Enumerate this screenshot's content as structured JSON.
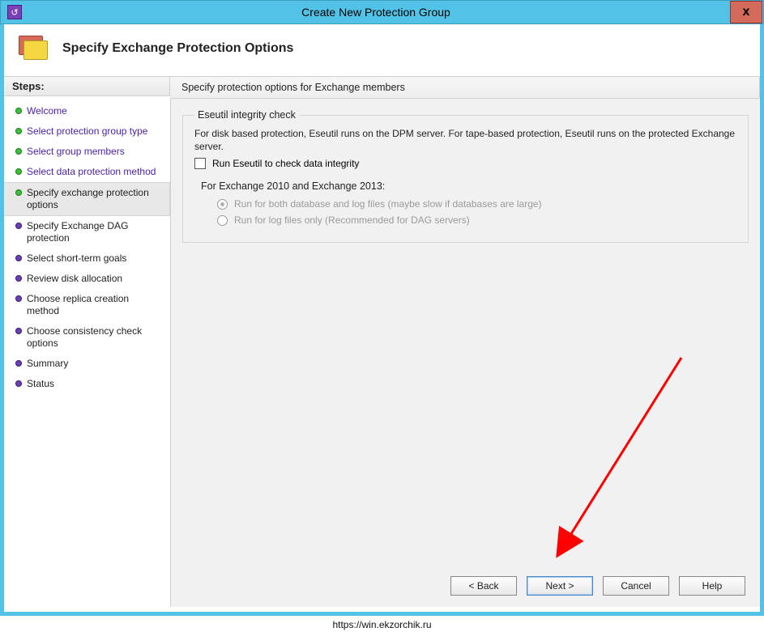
{
  "window": {
    "title": "Create New Protection Group"
  },
  "header": {
    "title": "Specify Exchange Protection Options"
  },
  "sidebar": {
    "heading": "Steps:",
    "items": [
      {
        "label": "Welcome",
        "state": "done",
        "link": true
      },
      {
        "label": "Select protection group type",
        "state": "done",
        "link": true
      },
      {
        "label": "Select group members",
        "state": "done",
        "link": true
      },
      {
        "label": "Select data protection method",
        "state": "done",
        "link": true
      },
      {
        "label": "Specify exchange protection options",
        "state": "current",
        "link": false
      },
      {
        "label": "Specify Exchange DAG protection",
        "state": "pending",
        "link": false
      },
      {
        "label": "Select short-term goals",
        "state": "pending",
        "link": false
      },
      {
        "label": "Review disk allocation",
        "state": "pending",
        "link": false
      },
      {
        "label": "Choose replica creation method",
        "state": "pending",
        "link": false
      },
      {
        "label": "Choose consistency check options",
        "state": "pending",
        "link": false
      },
      {
        "label": "Summary",
        "state": "pending",
        "link": false
      },
      {
        "label": "Status",
        "state": "pending",
        "link": false
      }
    ]
  },
  "main": {
    "heading": "Specify protection options for Exchange members",
    "group": {
      "legend": "Eseutil integrity check",
      "description": "For disk based protection, Eseutil runs on the DPM server. For tape-based protection, Eseutil runs on the protected Exchange server.",
      "checkbox_label": "Run Eseutil to check data integrity",
      "checkbox_checked": false,
      "sub_heading": "For Exchange 2010 and Exchange 2013:",
      "radio1": "Run for both database and log files (maybe slow if databases are large)",
      "radio2": "Run for log files only (Recommended for DAG servers)"
    }
  },
  "buttons": {
    "back": "< Back",
    "next": "Next >",
    "cancel": "Cancel",
    "help": "Help"
  },
  "footer_url": "https://win.ekzorchik.ru"
}
